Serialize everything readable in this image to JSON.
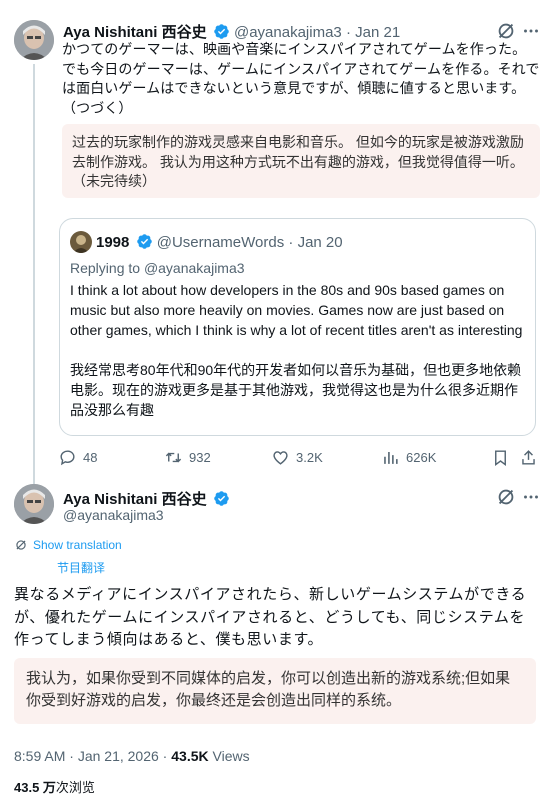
{
  "colors": {
    "accent": "#1d9bf0",
    "text": "#0f1419",
    "secondary": "#536471",
    "translation_bg": "#fbf1ef",
    "border": "#cfd9de"
  },
  "tweet1": {
    "name": "Aya Nishitani 西谷史",
    "handle": "@ayanakajima3",
    "date": "Jan 21",
    "body": "かつてのゲーマーは、映画や音楽にインスパイアされてゲームを作った。でも今日のゲーマーは、ゲームにインスパイアされてゲームを作る。それでは面白いゲームはできないという意見ですが、傾聴に値すると思います。（つづく）",
    "translation": "过去的玩家制作的游戏灵感来自电影和音乐。 但如今的玩家是被游戏激励去制作游戏。 我认为用这种方式玩不出有趣的游戏，但我觉得值得一听。（未完待续）",
    "icons": {
      "grok": "grok-icon",
      "more": "more-icon"
    }
  },
  "quote": {
    "name": "1998",
    "handle": "@UsernameWords",
    "date": "Jan 20",
    "replying_prefix": "Replying to ",
    "replying_handle": "@ayanakajima3",
    "body": "I think a lot about how developers in the 80s and 90s based games on music but also more heavily on movies. Games now are just based on other games, which I think is why a lot of recent titles aren't as interesting",
    "translation": "我经常思考80年代和90年代的开发者如何以音乐为基础，但也更多地依赖电影。现在的游戏更多是基于其他游戏，我觉得这也是为什么很多近期作品没那么有趣"
  },
  "actions": {
    "replies": "48",
    "reposts": "932",
    "likes": "3.2K",
    "views": "626K"
  },
  "tweet2": {
    "name": "Aya Nishitani 西谷史",
    "handle": "@ayanakajima3",
    "show_translation": "Show translation",
    "show_translation_cn": "节目翻译",
    "body": "異なるメディアにインスパイアされたら、新しいゲームシステムができるが、優れたゲームにインスパイアされると、どうしても、同じシステムを作ってしまう傾向はあると、僕も思います。",
    "translation": "我认为，如果你受到不同媒体的启发，你可以创造出新的游戏系统;但如果你受到好游戏的启发，你最终还是会创造出同样的系统。",
    "time": "8:59 AM",
    "date": "Jan 21, 2026",
    "views_count": "43.5K",
    "views_label": "Views",
    "views_cn_count": "43.5 万",
    "views_cn_label": "次浏览"
  }
}
